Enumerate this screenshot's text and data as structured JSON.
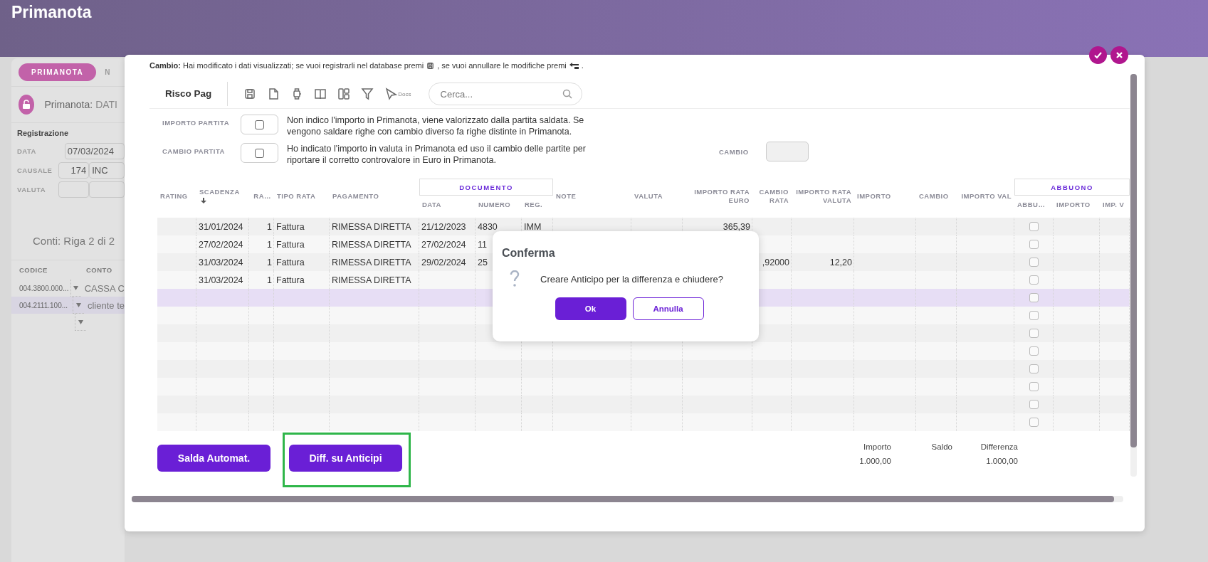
{
  "app": {
    "title": "Primanota"
  },
  "background_panel": {
    "tabs": [
      {
        "label": "PRIMANOTA",
        "selected": true
      },
      {
        "label": "N",
        "selected": false
      }
    ],
    "heading": {
      "label": "Primanota:",
      "value": "DATI"
    },
    "section": "Registrazione",
    "fields": [
      {
        "label": "DATA",
        "kind": "date",
        "value": "07/03/2024"
      },
      {
        "label": "CAUSALE",
        "kind": "code",
        "code": "174",
        "description": "INC"
      },
      {
        "label": "VALUTA",
        "kind": "code"
      }
    ],
    "conti": {
      "title": "Conti: Riga 2 di 2",
      "columns": [
        "CODICE",
        "CONTO"
      ],
      "rows": [
        {
          "codice": "004.3800.000...",
          "conto": "CASSA C",
          "selected": false
        },
        {
          "codice": "004.2111.100...",
          "conto": "cliente te",
          "selected": true
        },
        {
          "selected": false
        }
      ]
    }
  },
  "modal": {
    "notice": [
      "**Cambio:** Hai modificato i dati visualizzati; se vuoi registrarli nel database premi",
      ", se vuoi annullare le modifiche premi",
      "."
    ],
    "toolbar": {
      "title": "Risco Pag",
      "docs_label": "Docs",
      "search": {
        "placeholder": "Cerca..."
      }
    },
    "options": [
      {
        "label": "IMPORTO PARTITA",
        "checked": false,
        "description": "Non indico l'importo in Primanota, viene valorizzato dalla partita saldata. Se vengono saldare righe con cambio diverso fa righe distinte in Primanota."
      },
      {
        "label": "CAMBIO PARTITA",
        "checked": false,
        "description": "Ho indicato l'importo in valuta in Primanota ed uso il cambio delle partite per riportare il corretto controvalore in Euro in Primanota."
      }
    ],
    "cambio": {
      "label": "CAMBIO"
    },
    "table": {
      "columns": [
        {
          "label": "RATING",
          "sorted": false
        },
        {
          "label": "SCADENZA",
          "sorted": true
        },
        {
          "label": "RA…",
          "sorted": false
        },
        {
          "label": "TIPO RATA",
          "sorted": false
        },
        {
          "label": "PAGAMENTO",
          "sorted": false
        },
        {
          "group": "DOCUMENTO",
          "children": [
            {
              "label": "DATA",
              "sorted": false
            },
            {
              "label": "NUMERO",
              "sorted": false
            },
            {
              "label": "REG.",
              "sorted": false
            }
          ]
        },
        {
          "label": "NOTE",
          "sorted": false
        },
        {
          "label": "VALUTA",
          "sorted": false
        },
        {
          "label": "IMPORTO RATA EURO",
          "sorted": false
        },
        {
          "label": "CAMBIO RATA",
          "sorted": false
        },
        {
          "label": "IMPORTO RATA VALUTA",
          "sorted": false
        },
        {
          "label": "IMPORTO",
          "sorted": false
        },
        {
          "label": "CAMBIO",
          "sorted": false
        },
        {
          "label": "IMPORTO VAL",
          "sorted": false
        },
        {
          "group": "ABBUONO",
          "children": [
            {
              "label": "ABBU…",
              "kind": "checkbox",
              "sorted": false
            },
            {
              "label": "IMPORTO",
              "sorted": false
            },
            {
              "label": "IMP. V",
              "sorted": false
            }
          ]
        }
      ],
      "rows": [
        {
          "selected": false,
          "checked": false,
          "cells": [
            null,
            "31/01/2024",
            "1",
            "Fattura",
            "RIMESSA DIRETTA",
            "21/12/2023",
            "4830",
            "IMM",
            null,
            null,
            "365,39"
          ]
        },
        {
          "selected": false,
          "checked": false,
          "cells": [
            null,
            "27/02/2024",
            "1",
            "Fattura",
            "RIMESSA DIRETTA",
            "27/02/2024",
            "11"
          ]
        },
        {
          "selected": false,
          "checked": false,
          "cells": [
            null,
            "31/03/2024",
            "1",
            "Fattura",
            "RIMESSA DIRETTA",
            "29/02/2024",
            "25",
            null,
            null,
            null,
            null,
            ",92000",
            "12,20"
          ]
        },
        {
          "selected": false,
          "checked": false,
          "cells": [
            null,
            "31/03/2024",
            "1",
            "Fattura",
            "RIMESSA DIRETTA"
          ]
        },
        {
          "selected": true,
          "checked": false
        },
        {
          "selected": false,
          "checked": false
        },
        {
          "selected": false,
          "checked": false
        },
        {
          "selected": false,
          "checked": false
        },
        {
          "selected": false,
          "checked": false
        },
        {
          "selected": false,
          "checked": false
        },
        {
          "selected": false,
          "checked": false
        },
        {
          "selected": false,
          "checked": false
        }
      ]
    },
    "footer": {
      "buttons": [
        {
          "label": "Salda Automat.",
          "highlighted": false
        },
        {
          "label": "Diff. su Anticipi",
          "highlighted": true
        }
      ],
      "totals": [
        {
          "label": "Importo",
          "value": "1.000,00"
        },
        {
          "label": "Saldo"
        },
        {
          "label": "Differenza",
          "value": "1.000,00"
        }
      ]
    },
    "dialog": {
      "title": "Conferma",
      "message": "Creare Anticipo per la differenza e chiudere?",
      "buttons": [
        {
          "label": "Ok",
          "kind": "primary"
        },
        {
          "label": "Annulla",
          "kind": "secondary"
        }
      ]
    }
  }
}
